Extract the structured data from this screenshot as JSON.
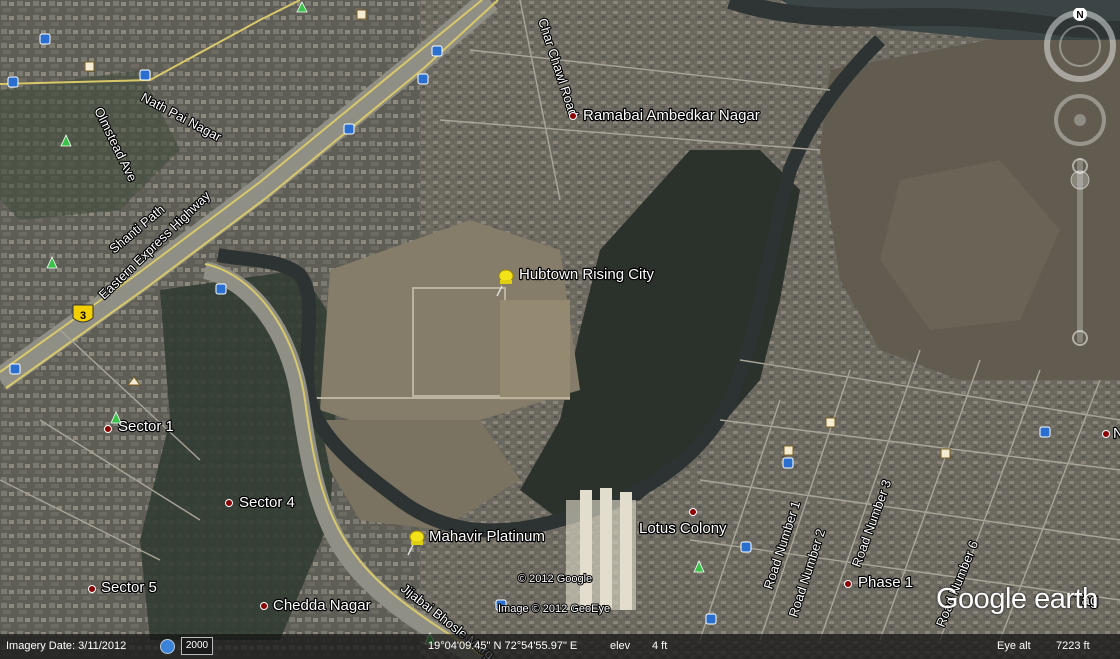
{
  "places": {
    "ramabai": "Ramabai Ambedkar Nagar",
    "hubtown": "Hubtown Rising City",
    "sector1": "Sector 1",
    "sector4": "Sector 4",
    "sector5": "Sector 5",
    "mahavir": "Mahavir Platinum",
    "lotus": "Lotus Colony",
    "phase1": "Phase 1",
    "chedda": "Chedda Nagar",
    "edge_n": "N",
    "edge_tag": "Tag"
  },
  "roads": {
    "char_chawl": "Char Chawl Road",
    "nath_pai": "Nath Pai Nagar",
    "olmstead": "Olmstead Ave",
    "shanti_path": "Shanti Path",
    "eastern_express": "Eastern Express Highway",
    "jijabai": "Jijabai Bhosle Marg",
    "road1": "Road Number 1",
    "road2": "Road Number 2",
    "road3": "Road Number 3",
    "road6": "Road Number 6"
  },
  "highway_shield": "3",
  "compass_north": "N",
  "copyright": {
    "google": "© 2012 Google",
    "geoeye": "Image © 2012 GeoEye"
  },
  "status": {
    "imagery_date": "Imagery Date: 3/11/2012",
    "year": "2000",
    "coords": "19°04'09.45\" N  72°54'55.97\" E",
    "elev_label": "elev",
    "elev_value": "4 ft",
    "eye_alt_label": "Eye alt",
    "eye_alt_value": "7223 ft"
  },
  "logo": "Google earth",
  "colors": {
    "label": "#ffffff",
    "placemark_pin": "#f2e21a",
    "poi_dot": "#8b0000",
    "transit_icon": "#2a6fd0",
    "park_icon": "#3bc24a",
    "highway_line": "#d8c86a"
  },
  "icons": {
    "placemark": "yellow-pushpin-icon",
    "poi": "red-dot-icon",
    "transit": "bus-stop-icon",
    "park": "tree-icon",
    "shield": "highway-shield-icon"
  }
}
